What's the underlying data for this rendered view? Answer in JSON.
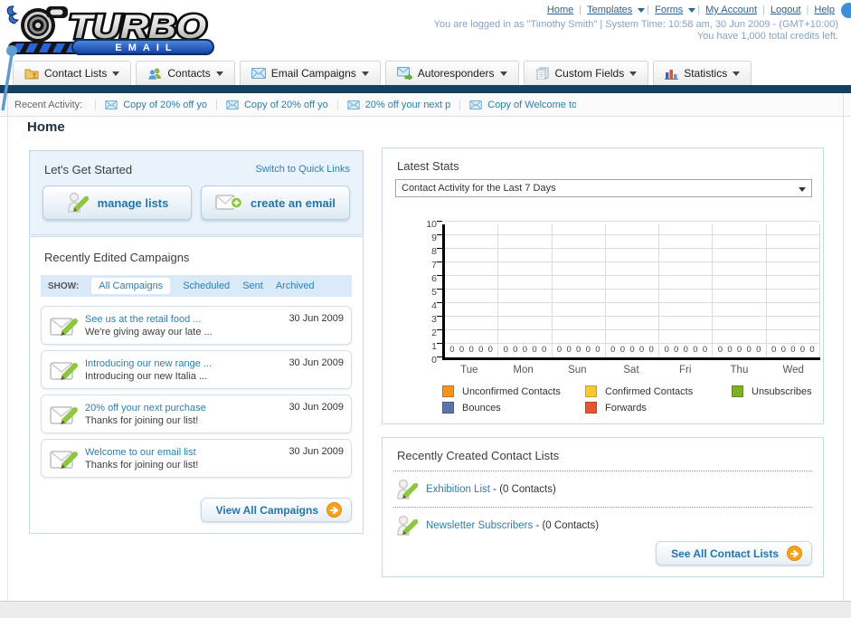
{
  "header": {
    "separator": "|",
    "nav": [
      {
        "label": "Home",
        "dropdown": false
      },
      {
        "label": "Templates",
        "dropdown": true
      },
      {
        "label": "Forms",
        "dropdown": true
      },
      {
        "label": "My Account",
        "dropdown": false
      },
      {
        "label": "Logout",
        "dropdown": false
      },
      {
        "label": "Help",
        "dropdown": false
      }
    ],
    "login_line": "You are logged in as \"Timothy Smith\" | System Time: 10:58 am, 30 Jun 2009 - (GMT+10:00)",
    "credits_line": "You have 1,000 total credits left.",
    "logo_title": "TURBO",
    "logo_subtitle": "EMAIL"
  },
  "tabs": [
    {
      "label": "Contact Lists"
    },
    {
      "label": "Contacts"
    },
    {
      "label": "Email Campaigns"
    },
    {
      "label": "Autoresponders"
    },
    {
      "label": "Custom Fields"
    },
    {
      "label": "Statistics"
    }
  ],
  "recent_activity": {
    "label": "Recent Activity:",
    "items": [
      "Copy of 20% off yo",
      "Copy of 20% off yo",
      "20% off your next p",
      "Copy of Welcome to"
    ]
  },
  "page_title": "Home",
  "get_started": {
    "title": "Let's Get Started",
    "switch_link": "Switch to Quick Links",
    "buttons": [
      {
        "label": "manage lists"
      },
      {
        "label": "create an email"
      }
    ]
  },
  "campaigns": {
    "title": "Recently Edited Campaigns",
    "show_label": "SHOW:",
    "filters": [
      "All Campaigns",
      "Scheduled",
      "Sent",
      "Archived"
    ],
    "active_filter": "All Campaigns",
    "rows": [
      {
        "title": "See us at the retail food ...",
        "subtitle": "We're giving away our late ...",
        "date": "30 Jun 2009"
      },
      {
        "title": "Introducing our new range ...",
        "subtitle": "Introducing our new Italia ...",
        "date": "30 Jun 2009"
      },
      {
        "title": "20% off your next purchase",
        "subtitle": "Thanks for joining our list!",
        "date": "30 Jun 2009"
      },
      {
        "title": "Welcome to our email list",
        "subtitle": "Thanks for joining our list!",
        "date": "30 Jun 2009"
      }
    ],
    "view_all_label": "View All Campaigns"
  },
  "stats": {
    "title": "Latest Stats",
    "selected_report": "Contact Activity for the Last 7 Days",
    "chart_data": {
      "type": "bar",
      "title": "Contact Activity for the Last 7 Days",
      "categories": [
        "Tue",
        "Mon",
        "Sun",
        "Sat",
        "Fri",
        "Thu",
        "Wed"
      ],
      "series": [
        {
          "name": "Unconfirmed Contacts",
          "color": "#f6921e",
          "values": [
            0,
            0,
            0,
            0,
            0,
            0,
            0
          ]
        },
        {
          "name": "Confirmed Contacts",
          "color": "#fdc72f",
          "values": [
            0,
            0,
            0,
            0,
            0,
            0,
            0
          ]
        },
        {
          "name": "Unsubscribes",
          "color": "#7ab222",
          "values": [
            0,
            0,
            0,
            0,
            0,
            0,
            0
          ]
        },
        {
          "name": "Bounces",
          "color": "#5975ac",
          "values": [
            0,
            0,
            0,
            0,
            0,
            0,
            0
          ]
        },
        {
          "name": "Forwards",
          "color": "#e8542e",
          "values": [
            0,
            0,
            0,
            0,
            0,
            0,
            0
          ]
        }
      ],
      "ylim": [
        0,
        10
      ],
      "ytick_step": 1,
      "grid": true,
      "legend_position": "bottom"
    }
  },
  "contact_lists": {
    "title": "Recently Created Contact Lists",
    "items": [
      {
        "name": "Exhibition List",
        "suffix": " - (0 Contacts)"
      },
      {
        "name": "Newsletter Subscribers",
        "suffix": " - (0 Contacts)"
      }
    ],
    "see_all_label": "See All Contact Lists"
  }
}
